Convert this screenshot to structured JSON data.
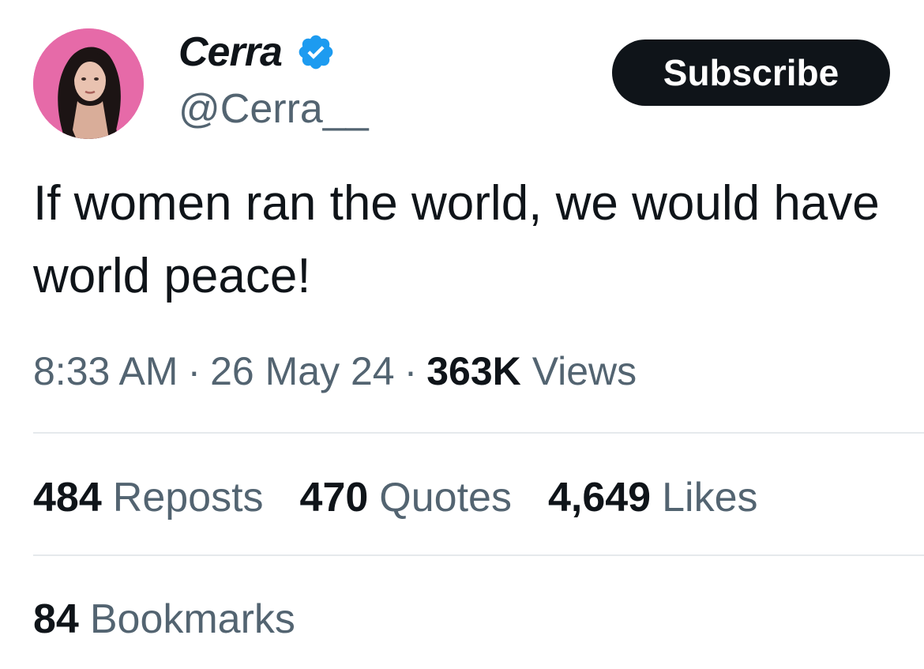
{
  "author": {
    "display_name": "Cerra",
    "handle": "@Cerra__",
    "verified": true,
    "verified_color": "#1d9bf0",
    "avatar_bg": "#e66aa8"
  },
  "subscribe_label": "Subscribe",
  "tweet": {
    "text": "If women ran the world, we would have world peace!",
    "time": "8:33 AM",
    "date": "26 May 24",
    "views_count": "363K",
    "views_label": "Views"
  },
  "stats": {
    "reposts": {
      "count": "484",
      "label": "Reposts"
    },
    "quotes": {
      "count": "470",
      "label": "Quotes"
    },
    "likes": {
      "count": "4,649",
      "label": "Likes"
    },
    "bookmarks": {
      "count": "84",
      "label": "Bookmarks"
    }
  },
  "colors": {
    "text_primary": "#0f1419",
    "text_secondary": "#536471",
    "divider": "#e5e9ec",
    "button_bg": "#0f1419"
  },
  "icons": {
    "verified": "verified-badge-icon"
  }
}
